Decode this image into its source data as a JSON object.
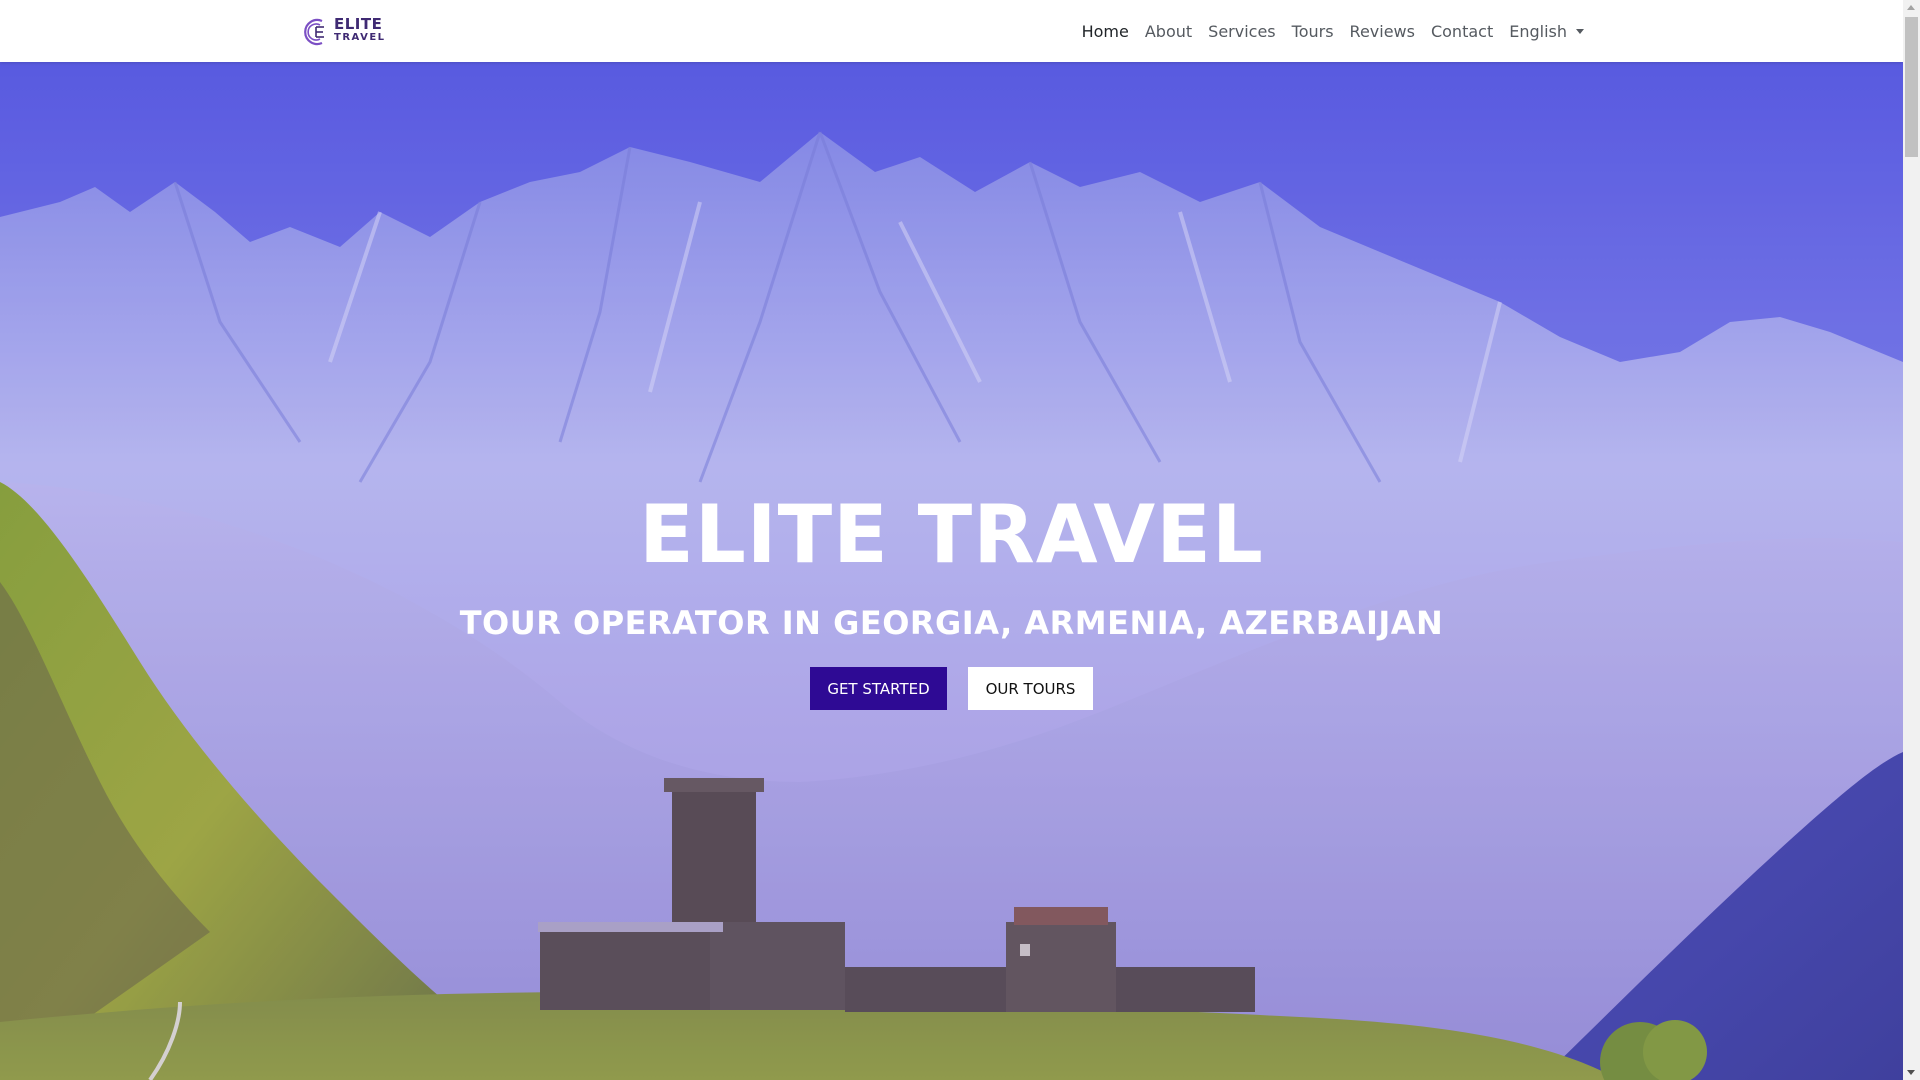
{
  "brand": {
    "name_line1": "ELITE",
    "name_line2": "TRAVEL",
    "logo_icon": "elite-travel-logo-icon"
  },
  "nav": {
    "items": [
      {
        "label": "Home",
        "active": true
      },
      {
        "label": "About",
        "active": false
      },
      {
        "label": "Services",
        "active": false
      },
      {
        "label": "Tours",
        "active": false
      },
      {
        "label": "Reviews",
        "active": false
      },
      {
        "label": "Contact",
        "active": false
      }
    ],
    "language": {
      "label": "English",
      "icon": "caret-down-icon"
    }
  },
  "hero": {
    "title": "ELITE TRAVEL",
    "subtitle": "TOUR OPERATOR IN GEORGIA, ARMENIA, AZERBAIJAN",
    "primary_button": "GET STARTED",
    "secondary_button": "OUR TOURS",
    "background": "mountain-village-photo"
  },
  "colors": {
    "primary": "#2e0a94",
    "brand": "#3f2a73",
    "nav_text": "#555a60",
    "nav_active": "#212529"
  }
}
